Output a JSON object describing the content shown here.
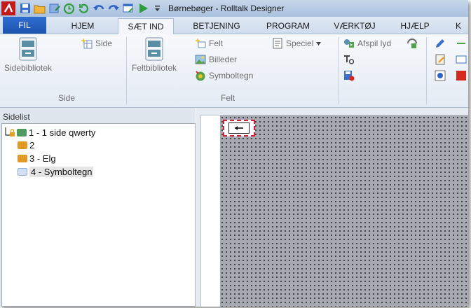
{
  "window": {
    "title": "Børnebøger - Rolltalk Designer"
  },
  "ribbon_tabs": [
    {
      "label": "FIL"
    },
    {
      "label": "HJEM"
    },
    {
      "label": "SÆT IND"
    },
    {
      "label": "BETJENING"
    },
    {
      "label": "PROGRAM"
    },
    {
      "label": "VÆRKTØJ"
    },
    {
      "label": "HJÆLP"
    },
    {
      "label": "K"
    }
  ],
  "active_tab": "SÆT IND",
  "groups": {
    "side": {
      "label": "Side",
      "library_label": "Sidebibliotek",
      "side_label": "Side"
    },
    "felt": {
      "label": "Felt",
      "library_label": "Feltbibliotek",
      "felt_label": "Felt",
      "billeder_label": "Billeder",
      "symboltegn_label": "Symboltegn",
      "speciel_label": "Speciel"
    },
    "actions": {
      "afspil_label": "Afspil lyd"
    }
  },
  "sidelist": {
    "title": "Sidelist",
    "items": [
      {
        "label": "1 - 1 side qwerty",
        "color": "#4e9b62"
      },
      {
        "label": "2",
        "color": "#e29a23"
      },
      {
        "label": "3 - Elg",
        "color": "#e29a23"
      },
      {
        "label": "4 - Symboltegn",
        "color": "#cfe0f4"
      }
    ]
  },
  "colors": {
    "accent": "#1d55ae",
    "selection_border": "#d0203a"
  }
}
